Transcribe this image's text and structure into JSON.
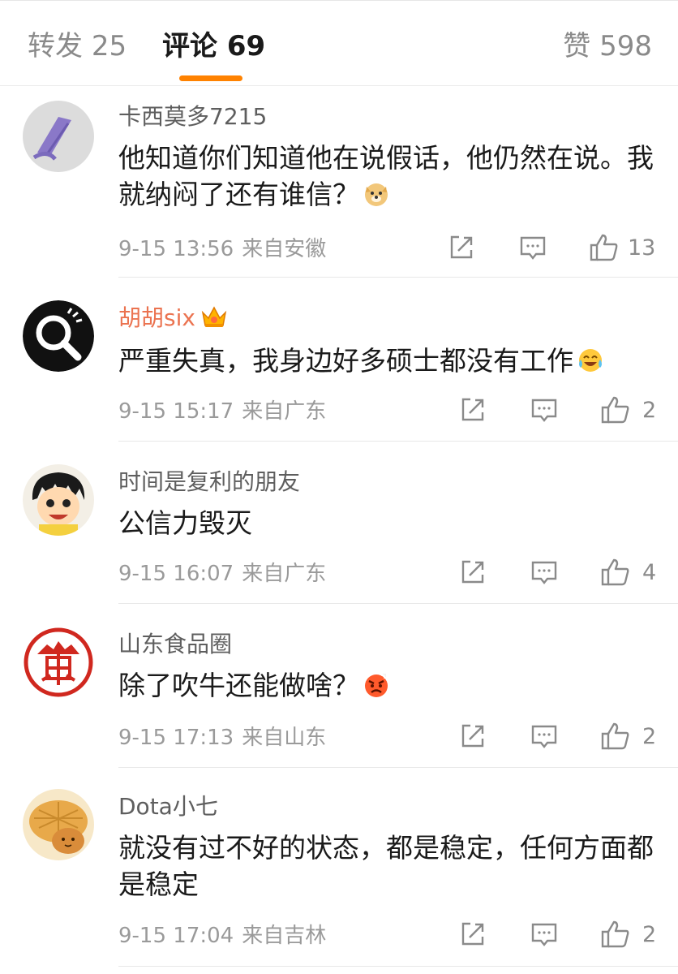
{
  "tabs": {
    "repost": {
      "label": "转发",
      "count": "25"
    },
    "comments": {
      "label": "评论",
      "count": "69"
    },
    "likes": {
      "label": "赞",
      "count": "598"
    }
  },
  "comments": [
    {
      "user": "卡西莫多7215",
      "text": "他知道你们知道他在说假话，他仍然在说。我就纳闷了还有谁信？",
      "emoji": "doge-emoji",
      "time": "9-15 13:56",
      "location": "来自安徽",
      "likes": "13"
    },
    {
      "user": "胡胡six",
      "badge": "crown-badge",
      "text": "严重失真，我身边好多硕士都没有工作",
      "emoji": "laugh-cry-emoji",
      "time": "9-15 15:17",
      "location": "来自广东",
      "likes": "2"
    },
    {
      "user": "时间是复利的朋友",
      "text": "公信力毁灭",
      "time": "9-15 16:07",
      "location": "来自广东",
      "likes": "4"
    },
    {
      "user": "山东食品圈",
      "text": "除了吹牛还能做啥？",
      "emoji": "angry-emoji",
      "time": "9-15 17:13",
      "location": "来自山东",
      "likes": "2"
    },
    {
      "user": "Dota小七",
      "text": "就没有过不好的状态，都是稳定，任何方面都是稳定",
      "time": "9-15 17:04",
      "location": "来自吉林",
      "likes": "2"
    }
  ],
  "colors": {
    "accent": "#ff8200",
    "vip_name": "#eb7350",
    "muted": "#9a9a9a"
  },
  "icons": {
    "share": "share-icon",
    "comment": "comment-icon",
    "like": "thumbs-up-icon"
  }
}
